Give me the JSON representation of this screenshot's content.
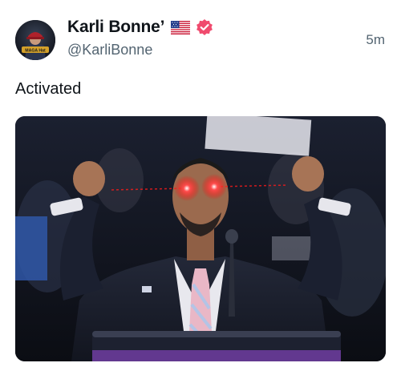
{
  "post": {
    "author": {
      "display_name": "Karli Bonne’",
      "handle": "@KarliBonne",
      "avatar_text": "MAGA Hat",
      "flag_icon": "us-flag-icon",
      "verified_icon": "verified-badge-icon"
    },
    "timestamp": "5m",
    "text": "Activated"
  },
  "colors": {
    "text_primary": "#0f1419",
    "text_secondary": "#536471",
    "verified_badge": "#f04b6e",
    "laser_eyes": "#ff1a1a"
  }
}
